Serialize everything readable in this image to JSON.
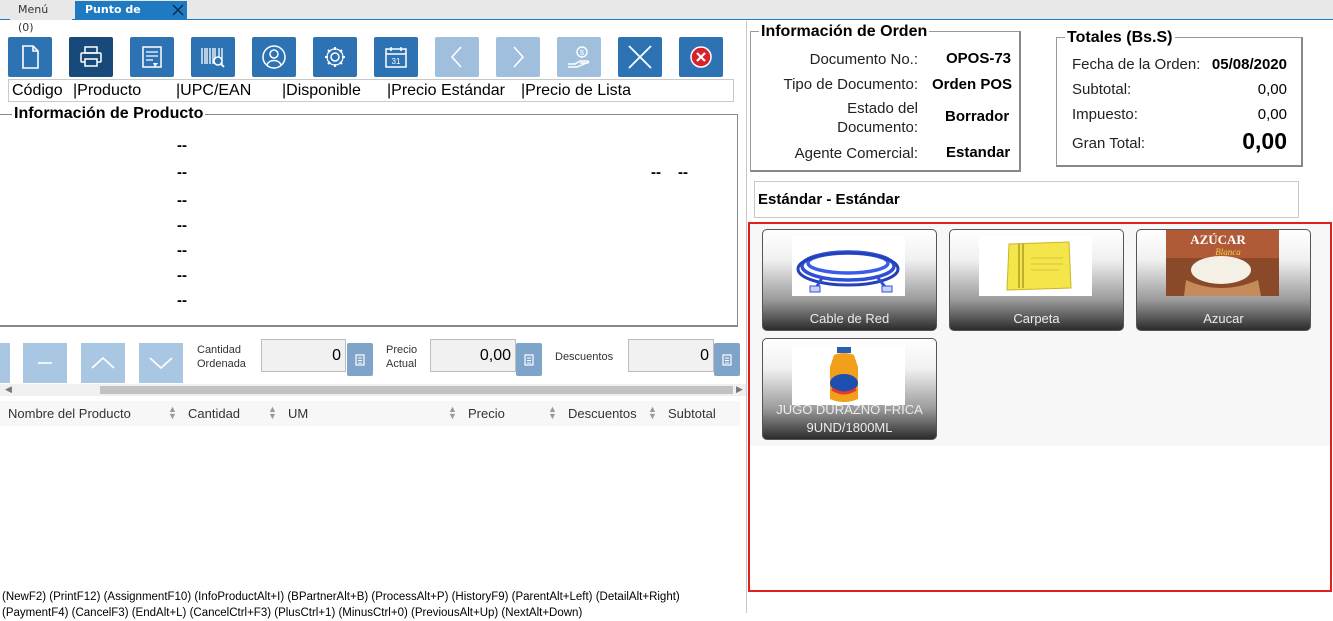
{
  "tabs": [
    {
      "label": "Menú (0)"
    },
    {
      "label": "Punto de Venta"
    }
  ],
  "toolbar": {
    "buttons": [
      "new-document-icon",
      "print-icon",
      "invoice-icon",
      "barcode-search-icon",
      "business-partner-icon",
      "settings-icon",
      "calendar-icon",
      "previous-icon",
      "next-icon",
      "payment-icon",
      "cancel-icon",
      "close-icon"
    ],
    "calendar_day": "31"
  },
  "product_columns": [
    "Código",
    "|Producto",
    "|UPC/EAN",
    "|Disponible",
    "|Precio Estándar",
    "|Precio de Lista"
  ],
  "product_info": {
    "title": "Información de Producto",
    "dashes": [
      "--",
      "--",
      "--",
      "--",
      "--",
      "--",
      "--"
    ],
    "right_dashes": [
      "--",
      "--"
    ]
  },
  "quantity": {
    "qty_label_1": "Cantidad",
    "qty_label_2": "Ordenada",
    "qty_value": "0",
    "price_label_1": "Precio",
    "price_label_2": "Actual",
    "price_value": "0,00",
    "discount_label": "Descuentos",
    "discount_value": "0"
  },
  "line_grid": {
    "columns": [
      "Nombre del Producto",
      "Cantidad",
      "UM",
      "Precio",
      "Descuentos",
      "Subtotal"
    ]
  },
  "shortcuts": {
    "line1": "(NewF2) (PrintF12) (AssignmentF10) (InfoProductAlt+I) (BPartnerAlt+B) (ProcessAlt+P) (HistoryF9) (ParentAlt+Left) (DetailAlt+Right)",
    "line2": "(PaymentF4) (CancelF3) (EndAlt+L) (CancelCtrl+F3) (PlusCtrl+1) (MinusCtrl+0) (PreviousAlt+Up) (NextAlt+Down)"
  },
  "order": {
    "title": "Información de Orden",
    "doc_no_label": "Documento No.:",
    "doc_no": "OPOS-73",
    "doc_type_label": "Tipo de Documento:",
    "doc_type": "Orden POS",
    "status_label_1": "Estado del",
    "status_label_2": "Documento:",
    "status": "Borrador",
    "agent_label": "Agente Comercial:",
    "agent": "Estandar"
  },
  "totals": {
    "title": "Totales (Bs.S)",
    "date_label": "Fecha de la Orden:",
    "date": "05/08/2020",
    "subtotal_label": "Subtotal:",
    "subtotal": "0,00",
    "tax_label": "Impuesto:",
    "tax": "0,00",
    "grand_label": "Gran Total:",
    "grand": "0,00"
  },
  "price_list": "Estándar - Estándar",
  "products": [
    {
      "name": "Cable de Red"
    },
    {
      "name": "Carpeta"
    },
    {
      "name": "Azucar"
    },
    {
      "name_1": "JUGO DURAZNO FRICA",
      "name_2": "9UND/1800ML"
    }
  ],
  "images": {
    "azucar_text_1": "AZÚCAR",
    "azucar_text_2": "Blanca"
  },
  "colors": {
    "accent": "#1f7bc1",
    "toolbar_button": "#2d73b4",
    "catalog_border": "#e02020"
  }
}
